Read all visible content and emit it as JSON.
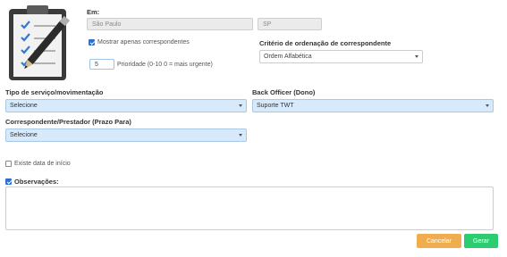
{
  "header": {
    "em_label": "Em:",
    "city_value": "São Paulo",
    "state_value": "SP",
    "mostrar_label": "Mostrar apenas correspondentes",
    "mostrar_checked": true,
    "prioridade_value": "5",
    "prioridade_label": "Prioridade (0-10 0 = mais urgente)",
    "criterio_label": "Critério de ordenação de correspondente",
    "criterio_value": "Ordem Alfabética"
  },
  "form": {
    "tipo_label": "Tipo de serviço/movimentação",
    "tipo_value": "Selecione",
    "back_office_label": "Back Officer (Dono)",
    "back_office_value": "Suporte TWT",
    "correspondente_label": "Correspondente/Prestador (Prazo Para)",
    "correspondente_value": "Selecione",
    "existe_label": "Existe data de início",
    "existe_checked": false,
    "observacoes_label": "Observações:",
    "observacoes_checked": true,
    "observacoes_value": ""
  },
  "actions": {
    "cancelar_label": "Cancelar",
    "gerar_label": "Gerar"
  },
  "colors": {
    "cancel": "#f0ad4e",
    "generate": "#2ecc71",
    "select_bg": "#d6eafc"
  },
  "icons": {
    "clipboard": "clipboard-checklist-icon"
  }
}
